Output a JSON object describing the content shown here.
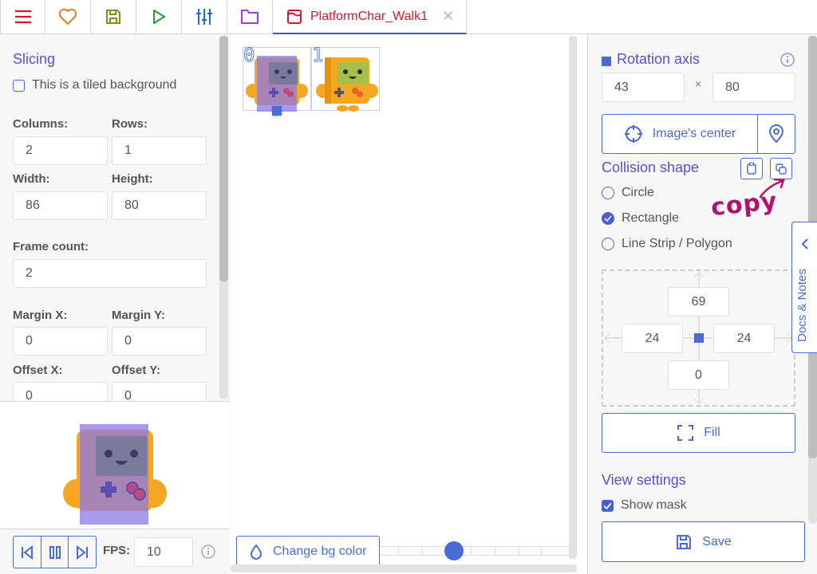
{
  "topbar": {
    "buttons": [
      {
        "name": "menu",
        "icon": "hamburger-icon",
        "color": "#d11a2a"
      },
      {
        "name": "patrons",
        "icon": "heart-icon",
        "color": "#d9822b"
      },
      {
        "name": "save-project",
        "icon": "save-icon",
        "color": "#8a8a1a"
      },
      {
        "name": "launch",
        "icon": "play-icon",
        "color": "#1aa23a"
      },
      {
        "name": "settings",
        "icon": "sliders-icon",
        "color": "#1a6ad1"
      },
      {
        "name": "assets",
        "icon": "folder-icon",
        "color": "#9b3fd1"
      }
    ],
    "tab": {
      "label": "PlatformChar_Walk1",
      "icon": "texture-icon",
      "color": "#d11a2a"
    }
  },
  "left": {
    "slicing_title": "Slicing",
    "tiled_label": "This is a tiled background",
    "tiled_checked": false,
    "columns_label": "Columns:",
    "columns_value": "2",
    "rows_label": "Rows:",
    "rows_value": "1",
    "width_label": "Width:",
    "width_value": "86",
    "height_label": "Height:",
    "height_value": "80",
    "frame_count_label": "Frame count:",
    "frame_count_value": "2",
    "margin_x_label": "Margin X:",
    "margin_x_value": "0",
    "margin_y_label": "Margin Y:",
    "margin_y_value": "0",
    "offset_x_label": "Offset X:",
    "offset_x_value": "0",
    "offset_y_label": "Offset Y:",
    "offset_y_value": "0",
    "fps_label": "FPS:",
    "fps_value": "10"
  },
  "center": {
    "frames": [
      "0",
      "1"
    ],
    "bg_button_label": "Change bg color",
    "zoom_slider_position": 0.4
  },
  "right": {
    "rotation_title": "Rotation axis",
    "axis_x": "43",
    "axis_sep": "×",
    "axis_y": "80",
    "image_center_label": "Image's center",
    "collision_title": "Collision shape",
    "shapes": [
      {
        "label": "Circle",
        "checked": false
      },
      {
        "label": "Rectangle",
        "checked": true
      },
      {
        "label": "Line Strip / Polygon",
        "checked": false
      }
    ],
    "rect_top": "69",
    "rect_left": "24",
    "rect_right": "24",
    "rect_bottom": "0",
    "fill_label": "Fill",
    "view_title": "View settings",
    "show_mask_label": "Show mask",
    "show_mask_checked": true,
    "save_label": "Save",
    "annotation": "copy"
  },
  "docs_tab_label": "Docs & Notes",
  "colors": {
    "accent": "#4b6bd4",
    "title": "#5a4fd6",
    "annotation": "#b0146a"
  }
}
